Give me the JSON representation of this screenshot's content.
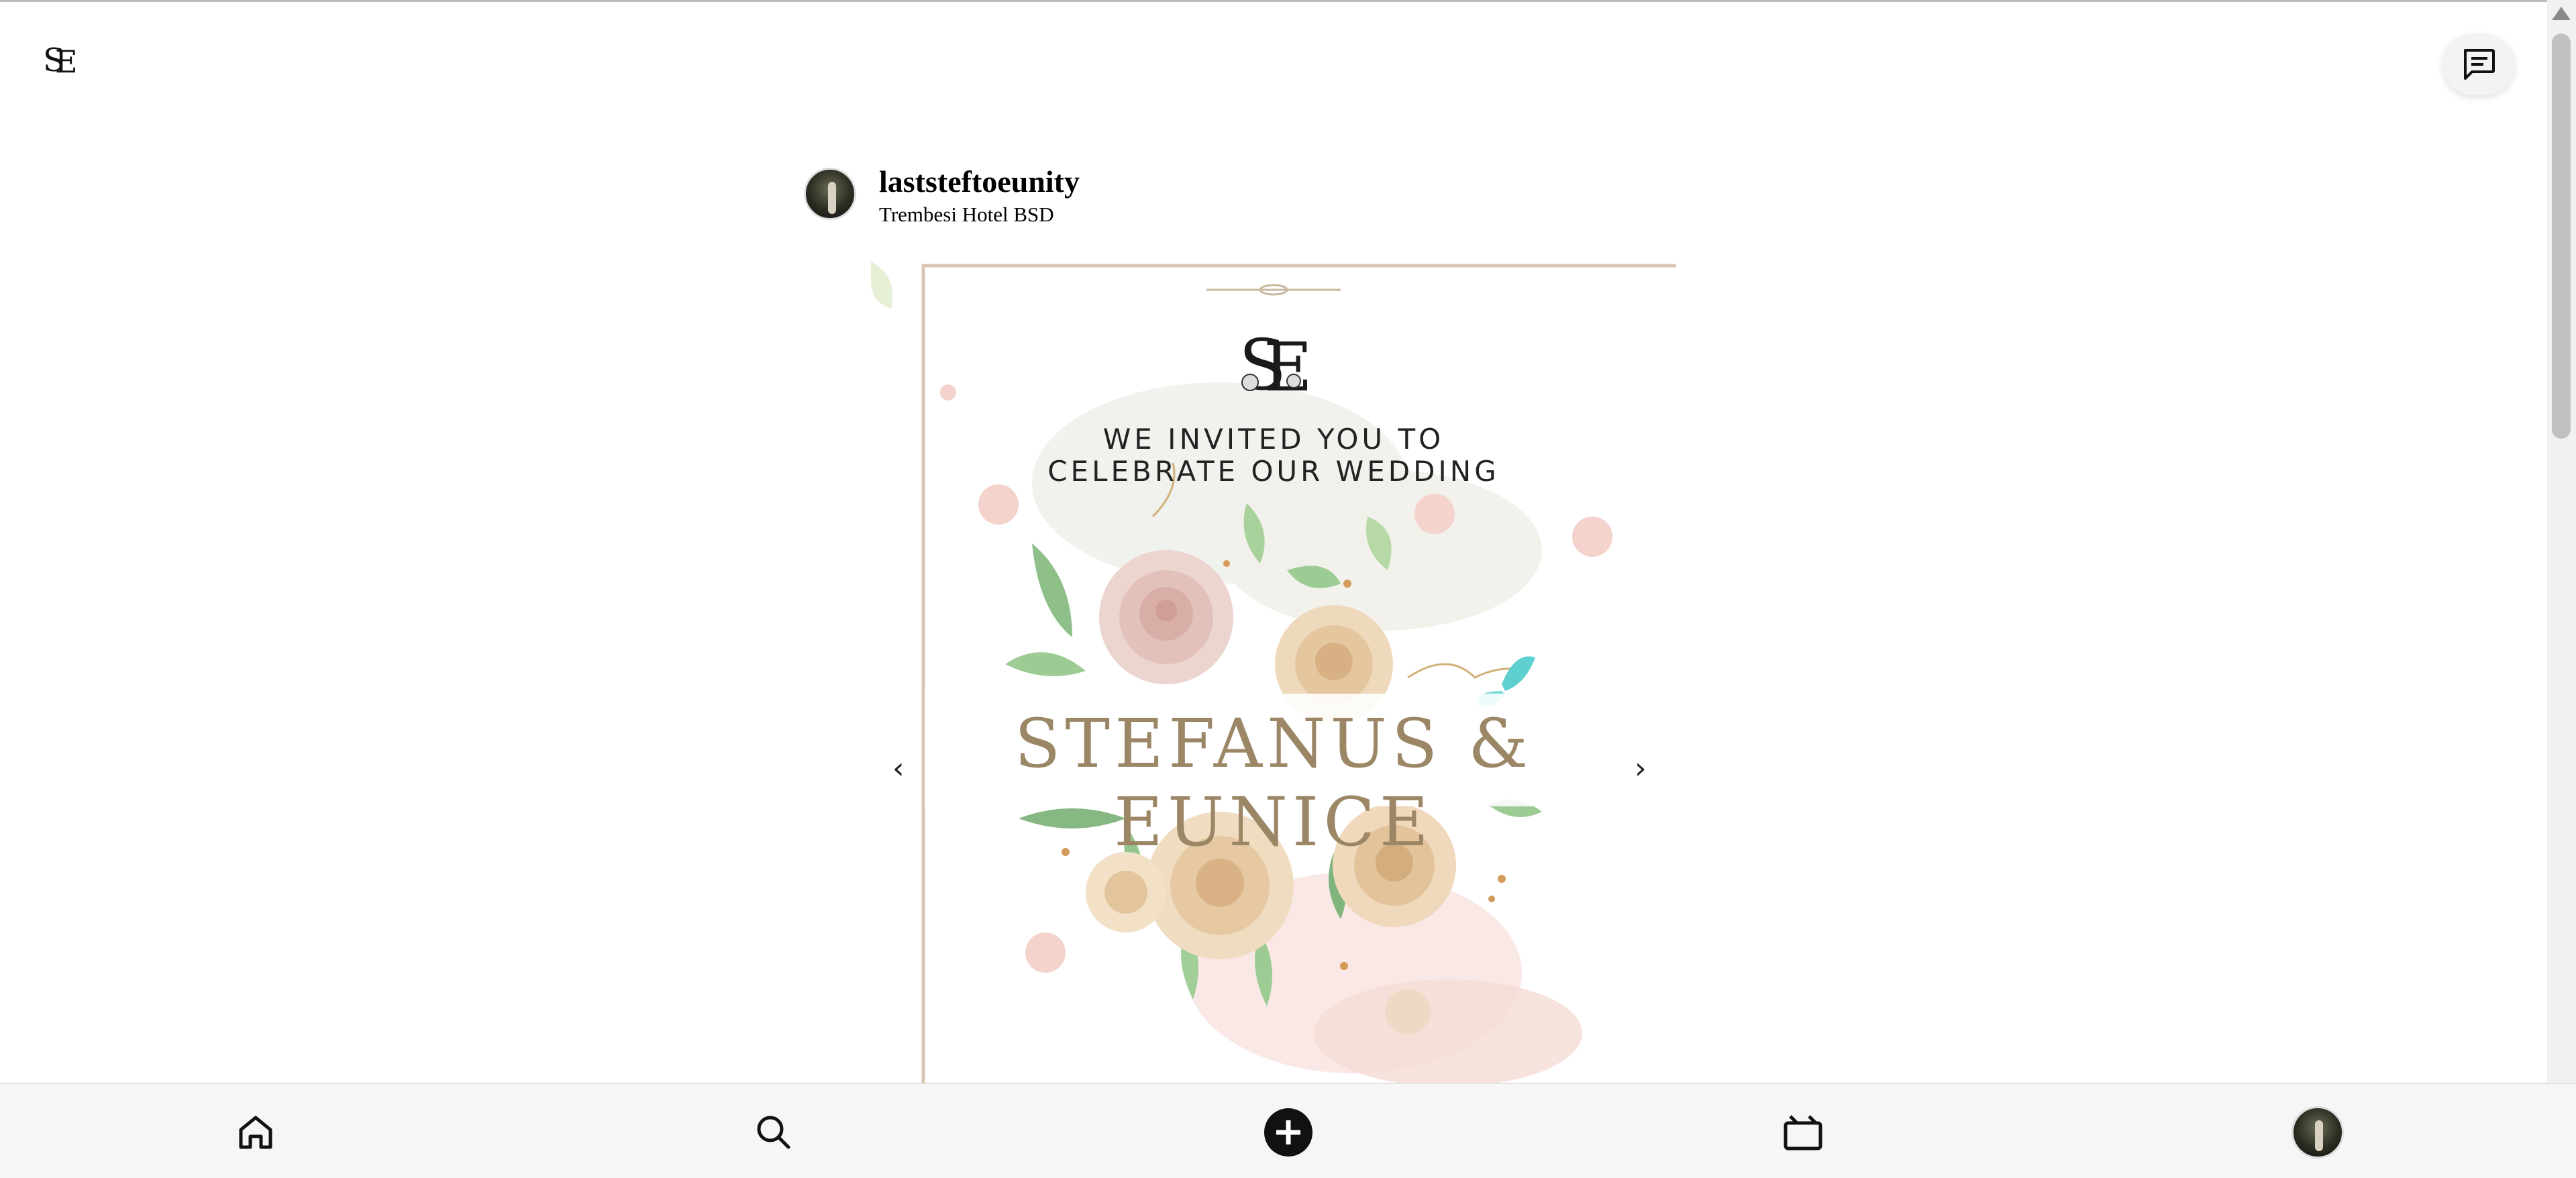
{
  "post": {
    "username": "laststeftoeunity",
    "location": "Trembesi Hotel BSD",
    "image": {
      "headline_line1": "WE INVITED YOU TO",
      "headline_line2": "CELEBRATE OUR WEDDING",
      "names": "STEFANUS & EUNICE",
      "monogram": "SE",
      "prev_arrow": "‹",
      "next_arrow": "›"
    }
  },
  "icons": {
    "logo": "se-monogram-logo",
    "messages": "chat-bubble-icon",
    "home": "home-icon",
    "search": "search-icon",
    "create": "plus-circle-icon",
    "reels": "clapperboard-icon",
    "profile": "profile-avatar"
  },
  "colors": {
    "names_gold": "#9b8665",
    "background": "#ffffff",
    "nav_background": "#f6f6f6"
  }
}
